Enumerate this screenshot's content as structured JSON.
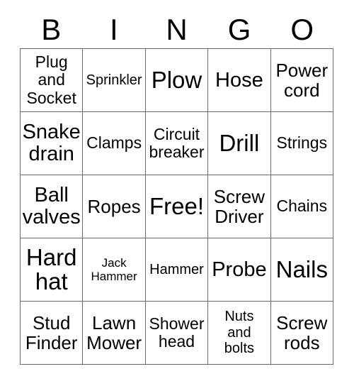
{
  "card": {
    "header": {
      "letters": [
        "B",
        "I",
        "N",
        "G",
        "O"
      ]
    },
    "rows": [
      [
        {
          "label": "Plug\nand\nSocket",
          "size": "m"
        },
        {
          "label": "Sprinkler",
          "size": "s"
        },
        {
          "label": "Plow",
          "size": "xxl"
        },
        {
          "label": "Hose",
          "size": "xl"
        },
        {
          "label": "Power\ncord",
          "size": "l"
        }
      ],
      [
        {
          "label": "Snake\ndrain",
          "size": "xl"
        },
        {
          "label": "Clamps",
          "size": "m"
        },
        {
          "label": "Circuit\nbreaker",
          "size": "m"
        },
        {
          "label": "Drill",
          "size": "xxl"
        },
        {
          "label": "Strings",
          "size": "m"
        }
      ],
      [
        {
          "label": "Ball\nvalves",
          "size": "xl"
        },
        {
          "label": "Ropes",
          "size": "l"
        },
        {
          "label": "Free!",
          "size": "xxl"
        },
        {
          "label": "Screw\nDriver",
          "size": "l"
        },
        {
          "label": "Chains",
          "size": "m"
        }
      ],
      [
        {
          "label": "Hard\nhat",
          "size": "xxl"
        },
        {
          "label": "Jack\nHammer",
          "size": "xs"
        },
        {
          "label": "Hammer",
          "size": "s"
        },
        {
          "label": "Probe",
          "size": "xl"
        },
        {
          "label": "Nails",
          "size": "xxl"
        }
      ],
      [
        {
          "label": "Stud\nFinder",
          "size": "l"
        },
        {
          "label": "Lawn\nMower",
          "size": "l"
        },
        {
          "label": "Shower\nhead",
          "size": "m"
        },
        {
          "label": "Nuts\nand\nbolts",
          "size": "s"
        },
        {
          "label": "Screw\nrods",
          "size": "l"
        }
      ]
    ],
    "colors": {
      "background": "#ffffff",
      "text": "#000000",
      "grid_line": "#6b6b6b"
    },
    "free_space": "Free!"
  }
}
